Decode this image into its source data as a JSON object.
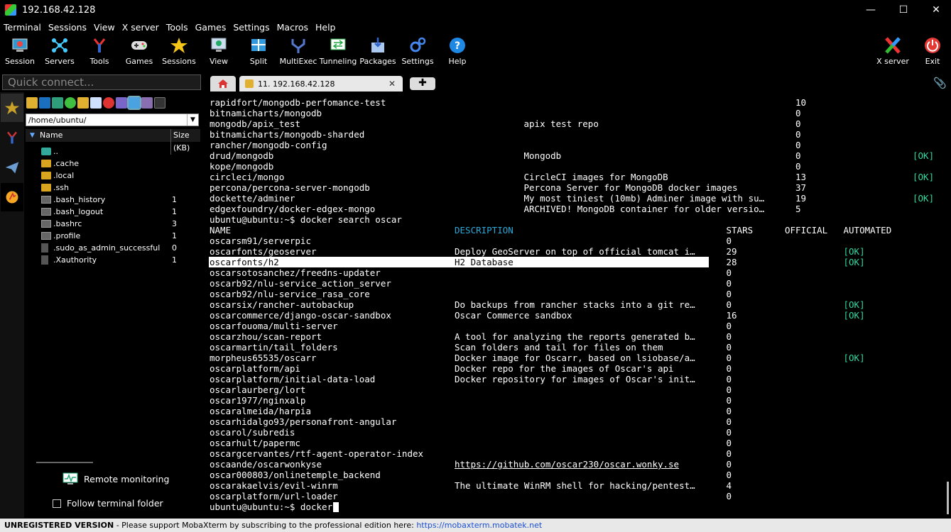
{
  "window": {
    "title": "192.168.42.128"
  },
  "menu": [
    "Terminal",
    "Sessions",
    "View",
    "X server",
    "Tools",
    "Games",
    "Settings",
    "Macros",
    "Help"
  ],
  "toolbar": [
    {
      "label": "Session",
      "icon": "session-icon"
    },
    {
      "label": "Servers",
      "icon": "servers-icon"
    },
    {
      "label": "Tools",
      "icon": "tools-icon"
    },
    {
      "label": "Games",
      "icon": "games-icon"
    },
    {
      "label": "Sessions",
      "icon": "star-icon"
    },
    {
      "label": "View",
      "icon": "view-icon"
    },
    {
      "label": "Split",
      "icon": "split-icon"
    },
    {
      "label": "MultiExec",
      "icon": "multiexec-icon"
    },
    {
      "label": "Tunneling",
      "icon": "tunneling-icon"
    },
    {
      "label": "Packages",
      "icon": "packages-icon"
    },
    {
      "label": "Settings",
      "icon": "settings-icon"
    },
    {
      "label": "Help",
      "icon": "help-icon"
    },
    {
      "label": "X server",
      "icon": "xserver-icon"
    },
    {
      "label": "Exit",
      "icon": "exit-icon"
    }
  ],
  "quick_connect": {
    "placeholder": "Quick connect..."
  },
  "sidebar": {
    "path": "/home/ubuntu/",
    "col_name": "Name",
    "col_size": "Size (KB)",
    "files": [
      {
        "name": "..",
        "size": "",
        "type": "up"
      },
      {
        "name": ".cache",
        "size": "",
        "type": "folder"
      },
      {
        "name": ".local",
        "size": "",
        "type": "folder"
      },
      {
        "name": ".ssh",
        "size": "",
        "type": "folder"
      },
      {
        "name": ".bash_history",
        "size": "1",
        "type": "file"
      },
      {
        "name": ".bash_logout",
        "size": "1",
        "type": "file"
      },
      {
        "name": ".bashrc",
        "size": "3",
        "type": "file"
      },
      {
        "name": ".profile",
        "size": "1",
        "type": "file"
      },
      {
        "name": ".sudo_as_admin_successful",
        "size": "0",
        "type": "doc"
      },
      {
        "name": ".Xauthority",
        "size": "1",
        "type": "doc"
      }
    ],
    "remote_monitoring": "Remote monitoring",
    "follow_folder": "Follow terminal folder"
  },
  "tabs": {
    "session_label": "11. 192.168.42.128"
  },
  "terminal": {
    "top_rows": [
      {
        "name": "rapidfort/mongodb-perfomance-test",
        "desc": "",
        "stars": "10",
        "ok": ""
      },
      {
        "name": "bitnamicharts/mongodb",
        "desc": "",
        "stars": "0",
        "ok": ""
      },
      {
        "name": "mongodb/apix_test",
        "desc": "apix test repo",
        "stars": "0",
        "ok": ""
      },
      {
        "name": "bitnamicharts/mongodb-sharded",
        "desc": "",
        "stars": "0",
        "ok": ""
      },
      {
        "name": "rancher/mongodb-config",
        "desc": "",
        "stars": "0",
        "ok": ""
      },
      {
        "name": "drud/mongodb",
        "desc": "Mongodb",
        "stars": "0",
        "ok": "[OK]"
      },
      {
        "name": "kope/mongodb",
        "desc": "",
        "stars": "0",
        "ok": ""
      },
      {
        "name": "circleci/mongo",
        "desc": "CircleCI images for MongoDB",
        "stars": "13",
        "ok": "[OK]"
      },
      {
        "name": "percona/percona-server-mongodb",
        "desc": "Percona Server for MongoDB docker images",
        "stars": "37",
        "ok": ""
      },
      {
        "name": "dockette/adminer",
        "desc": "My most tiniest (10mb) Adminer image with su…",
        "stars": "19",
        "ok": "[OK]"
      },
      {
        "name": "edgexfoundry/docker-edgex-mongo",
        "desc": "ARCHIVED! MongoDB container for older versio…",
        "stars": "5",
        "ok": ""
      }
    ],
    "command1": "ubuntu@ubuntu:~$ docker search oscar",
    "header": {
      "name": "NAME",
      "desc": "DESCRIPTION",
      "stars": "STARS",
      "official": "OFFICIAL",
      "automated": "AUTOMATED"
    },
    "rows": [
      {
        "name": "oscarsm91/serverpic",
        "desc": "",
        "stars": "0",
        "ok": ""
      },
      {
        "name": "oscarfonts/geoserver",
        "desc": "Deploy GeoServer on top of official tomcat i…",
        "stars": "29",
        "ok": "[OK]"
      },
      {
        "name": "oscarfonts/h2",
        "desc": "H2 Database",
        "stars": "28",
        "ok": "[OK]"
      },
      {
        "name": "oscarsotosanchez/freedns-updater",
        "desc": "",
        "stars": "0",
        "ok": ""
      },
      {
        "name": "oscarb92/nlu-service_action_server",
        "desc": "",
        "stars": "0",
        "ok": ""
      },
      {
        "name": "oscarb92/nlu-service_rasa_core",
        "desc": "",
        "stars": "0",
        "ok": ""
      },
      {
        "name": "oscarsix/rancher-autobackup",
        "desc": "Do backups from rancher stacks into a git re…",
        "stars": "0",
        "ok": "[OK]"
      },
      {
        "name": "oscarcommerce/django-oscar-sandbox",
        "desc": "Oscar Commerce sandbox",
        "stars": "16",
        "ok": "[OK]"
      },
      {
        "name": "oscarfouoma/multi-server",
        "desc": "",
        "stars": "0",
        "ok": ""
      },
      {
        "name": "oscarzhou/scan-report",
        "desc": "A tool for analyzing the reports generated b…",
        "stars": "0",
        "ok": ""
      },
      {
        "name": "oscarmartin/tail_folders",
        "desc": "Scan folders and tail for files on them",
        "stars": "0",
        "ok": ""
      },
      {
        "name": "morpheus65535/oscarr",
        "desc": "Docker image for Oscarr, based on lsiobase/a…",
        "stars": "0",
        "ok": "[OK]"
      },
      {
        "name": "oscarplatform/api",
        "desc": "Docker repo for the images of Oscar's api",
        "stars": "0",
        "ok": ""
      },
      {
        "name": "oscarplatform/initial-data-load",
        "desc": "Docker repository for images of Oscar's init…",
        "stars": "0",
        "ok": ""
      },
      {
        "name": "oscarlaurberg/lort",
        "desc": "",
        "stars": "0",
        "ok": ""
      },
      {
        "name": "oscar1977/nginxalp",
        "desc": "",
        "stars": "0",
        "ok": ""
      },
      {
        "name": "oscaralmeida/harpia",
        "desc": "",
        "stars": "0",
        "ok": ""
      },
      {
        "name": "oscarhidalgo93/personafront-angular",
        "desc": "",
        "stars": "0",
        "ok": ""
      },
      {
        "name": "oscarol/subredis",
        "desc": "",
        "stars": "0",
        "ok": ""
      },
      {
        "name": "oscarhult/papermc",
        "desc": "",
        "stars": "0",
        "ok": ""
      },
      {
        "name": "oscargcervantes/rtf-agent-operator-index",
        "desc": "",
        "stars": "0",
        "ok": ""
      },
      {
        "name": "oscaande/oscarwonkyse",
        "desc": "https://github.com/oscar230/oscar.wonky.se",
        "stars": "0",
        "ok": ""
      },
      {
        "name": "oscar000803/onlinetemple_backend",
        "desc": "",
        "stars": "0",
        "ok": ""
      },
      {
        "name": "oscarakaelvis/evil-winrm",
        "desc": "The ultimate WinRM shell for hacking/pentest…",
        "stars": "4",
        "ok": ""
      },
      {
        "name": "oscarplatform/url-loader",
        "desc": "",
        "stars": "0",
        "ok": ""
      }
    ],
    "prompt": "ubuntu@ubuntu:~$ docker"
  },
  "status": {
    "bold": "UNREGISTERED VERSION",
    "text": "  -  Please support MobaXterm by subscribing to the professional edition here:  ",
    "link": "https://mobaxterm.mobatek.net"
  }
}
